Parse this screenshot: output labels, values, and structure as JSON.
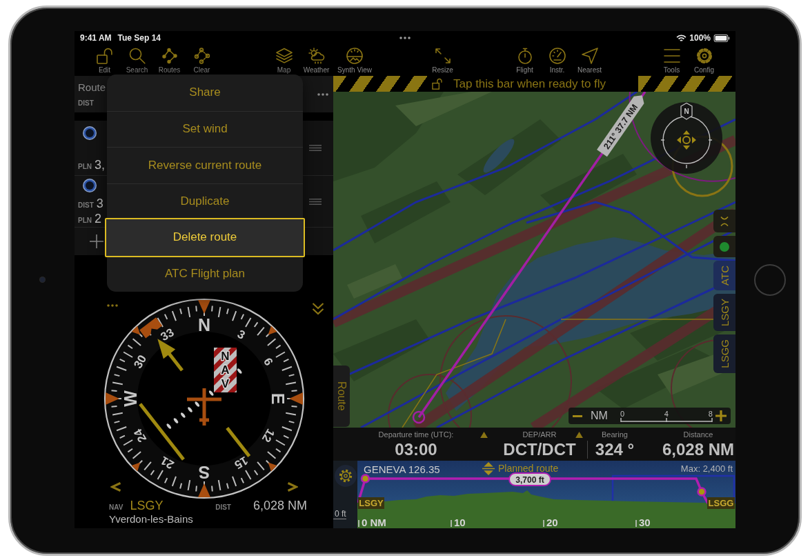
{
  "status_bar": {
    "time": "9:41 AM",
    "date": "Tue Sep 14",
    "battery": "100%"
  },
  "toolbar": {
    "groups": [
      [
        {
          "kind": "edit",
          "label": "Edit"
        },
        {
          "kind": "search",
          "label": "Search"
        },
        {
          "kind": "routes",
          "label": "Routes"
        },
        {
          "kind": "clear",
          "label": "Clear"
        }
      ],
      [
        {
          "kind": "map",
          "label": "Map"
        },
        {
          "kind": "weather",
          "label": "Weather"
        },
        {
          "kind": "synth",
          "label": "Synth View"
        }
      ],
      [
        {
          "kind": "resize",
          "label": "Resize"
        }
      ],
      [
        {
          "kind": "flight",
          "label": "Flight"
        },
        {
          "kind": "instr",
          "label": "Instr."
        },
        {
          "kind": "nearest",
          "label": "Nearest"
        }
      ],
      [
        {
          "kind": "tools",
          "label": "Tools"
        },
        {
          "kind": "config",
          "label": "Config"
        }
      ]
    ]
  },
  "routes_panel": {
    "title": "Route",
    "dist_label": "DIST",
    "rows": [
      {
        "lines": [
          {
            "label": "PLN",
            "value": "3,"
          }
        ]
      },
      {
        "lines": [
          {
            "label": "DIST",
            "value": "3"
          },
          {
            "label": "PLN",
            "value": "2"
          }
        ]
      }
    ]
  },
  "menu": {
    "items": [
      {
        "label": "Share",
        "selected": false
      },
      {
        "label": "Set wind",
        "selected": false
      },
      {
        "label": "Reverse current route",
        "selected": false
      },
      {
        "label": "Duplicate",
        "selected": false
      },
      {
        "label": "Delete route",
        "selected": true
      },
      {
        "label": "ATC Flight plan",
        "selected": false
      }
    ]
  },
  "hsi": {
    "card_labels": [
      "N",
      "3",
      "6",
      "E",
      "12",
      "15",
      "S",
      "21",
      "24",
      "W",
      "30",
      "33"
    ],
    "flag": "NAV",
    "nav_label": "NAV",
    "waypoint": "LSGY",
    "dist_label": "DIST",
    "distance": "6,028 NM",
    "waypoint_name": "Yverdon-les-Bains"
  },
  "ready_bar": {
    "text": "Tap this bar when ready to fly"
  },
  "map": {
    "route_label": "211° 37.7 NM",
    "compass_north": "N",
    "side_tabs": [
      {
        "kind": "brackets",
        "selected": false
      },
      {
        "kind": "status",
        "color": "#1f8a2e",
        "selected": false
      },
      {
        "kind": "label",
        "label": "ATC",
        "selected": true
      },
      {
        "kind": "label",
        "label": "LSGY",
        "selected": false
      },
      {
        "kind": "label",
        "label": "LSGG",
        "selected": false
      }
    ],
    "route_tab": "Route",
    "scale": {
      "unit": "NM",
      "ticks": [
        "0",
        "4",
        "8"
      ]
    }
  },
  "flight_info": {
    "fields": [
      {
        "label": "Departure time (UTC):",
        "value": "03:00",
        "flagged": true
      },
      {
        "label": "DEP/ARR",
        "value": "DCT/DCT",
        "flagged": true
      },
      {
        "label": "Bearing",
        "value": "324 °",
        "flagged": false
      },
      {
        "label": "Distance",
        "value": "6,028 NM",
        "flagged": false
      }
    ]
  },
  "profile": {
    "frequency": "GENEVA 126.35",
    "mode": "Planned route",
    "max": "Max: 2,400 ft",
    "altitude": "3,700 ft",
    "from": "LSGY",
    "to": "LSGG",
    "floor": "0 ft",
    "axis": [
      "0 NM",
      "10",
      "20",
      "30"
    ]
  }
}
